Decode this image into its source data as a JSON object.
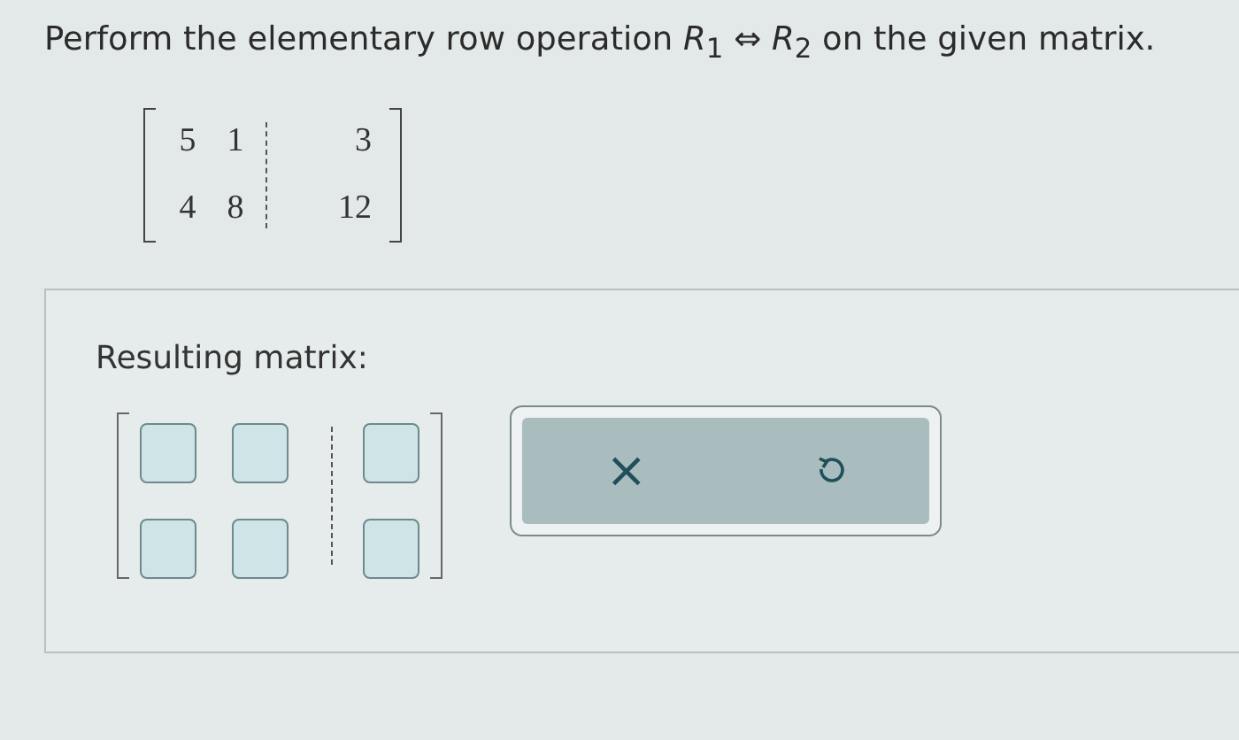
{
  "question": "Perform the elementary row operation *R*$_{1}$ ⇔ *R*$_{2}$ on the given matrix.",
  "given_matrix": {
    "rows": [
      [
        "5",
        "1",
        "3"
      ],
      [
        "4",
        "8",
        "12"
      ]
    ]
  },
  "answer": {
    "label": "Resulting matrix:",
    "rows": [
      [
        {
          "kind": "entry"
        },
        {
          "kind": "entry"
        },
        {
          "kind": "entry"
        }
      ],
      [
        {
          "kind": "entry"
        },
        {
          "kind": "entry"
        },
        {
          "kind": "entry"
        }
      ]
    ]
  },
  "actions": {
    "clear": "×"
  }
}
